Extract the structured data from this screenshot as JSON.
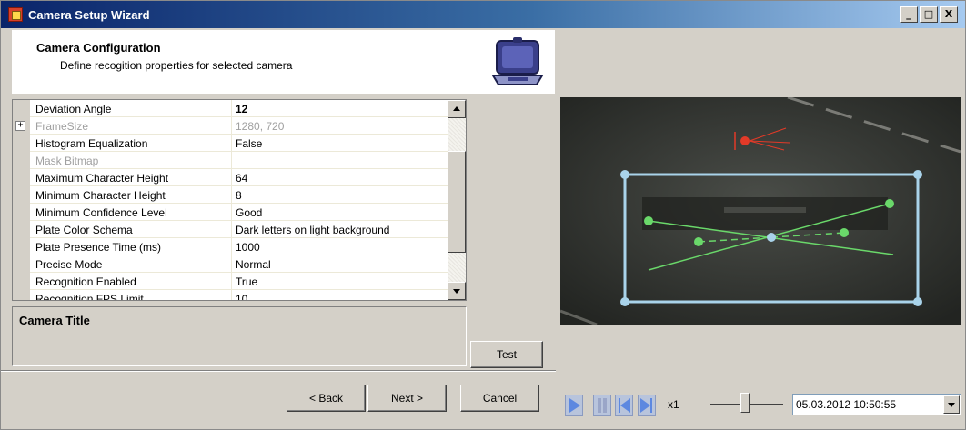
{
  "window": {
    "title": "Camera Setup Wizard",
    "btn_min": "_",
    "btn_max": "□",
    "btn_close": "X"
  },
  "header": {
    "title": "Camera Configuration",
    "subtitle": "Define recogition properties for selected camera"
  },
  "properties": [
    {
      "name": "Deviation Angle",
      "value": "12",
      "bold": true,
      "disabled": false,
      "expandable": false
    },
    {
      "name": "FrameSize",
      "value": "1280, 720",
      "bold": false,
      "disabled": true,
      "expandable": true
    },
    {
      "name": "Histogram Equalization",
      "value": "False",
      "bold": false,
      "disabled": false,
      "expandable": false
    },
    {
      "name": "Mask Bitmap",
      "value": "",
      "bold": false,
      "disabled": true,
      "expandable": false
    },
    {
      "name": "Maximum Character Height",
      "value": "64",
      "bold": false,
      "disabled": false,
      "expandable": false
    },
    {
      "name": "Minimum Character Height",
      "value": "8",
      "bold": false,
      "disabled": false,
      "expandable": false
    },
    {
      "name": "Minimum Confidence Level",
      "value": "Good",
      "bold": false,
      "disabled": false,
      "expandable": false
    },
    {
      "name": "Plate Color Schema",
      "value": "Dark letters on light background",
      "bold": false,
      "disabled": false,
      "expandable": false
    },
    {
      "name": "Plate Presence Time (ms)",
      "value": "1000",
      "bold": false,
      "disabled": false,
      "expandable": false
    },
    {
      "name": "Precise Mode",
      "value": "Normal",
      "bold": false,
      "disabled": false,
      "expandable": false
    },
    {
      "name": "Recognition Enabled",
      "value": "True",
      "bold": false,
      "disabled": false,
      "expandable": false
    },
    {
      "name": "Recognition FPS Limit",
      "value": "10",
      "bold": false,
      "disabled": false,
      "expandable": false
    }
  ],
  "expand_glyph": "+",
  "description": {
    "title": "Camera Title"
  },
  "buttons": {
    "test": "Test",
    "back": "< Back",
    "next": "Next >",
    "cancel": "Cancel"
  },
  "player": {
    "speed": "x1",
    "datetime": "05.03.2012 10:50:55"
  },
  "colors": {
    "overlay_box": "#a9d3ea",
    "overlay_line": "#6ad86a",
    "overlay_red": "#e23a28"
  }
}
